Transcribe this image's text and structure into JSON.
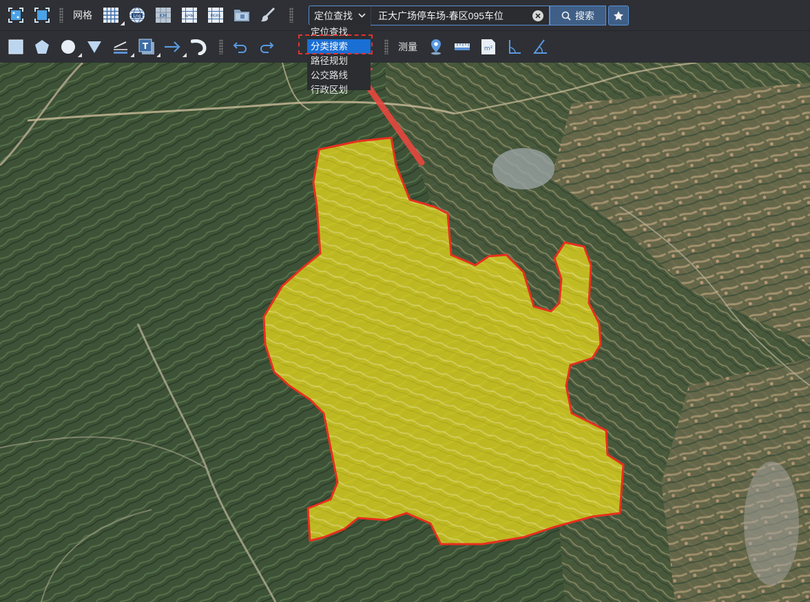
{
  "toolbar1": {
    "grid_label": "网格"
  },
  "search": {
    "type_selected": "定位查找",
    "value": "正大广场停车场-春区095车位",
    "button_label": "搜索",
    "dropdown_options": [
      "定位查找",
      "分类搜索",
      "路径规划",
      "公交路线",
      "行政区划"
    ],
    "highlighted_option": "分类搜索"
  },
  "toolbar2": {
    "measure_label": "测量"
  },
  "icons": {
    "toolbar1": [
      "fullscreen-fit-icon",
      "fullscreen-icon",
      "grid-icon",
      "lnglat-grid-icon",
      "km-grid-icon",
      "nm-grid-icon",
      "mgrs-grid-icon",
      "folder-icon",
      "brush-icon"
    ],
    "toolbar2": [
      "rectangle-icon",
      "polygon-icon",
      "circle-icon",
      "triangle-icon",
      "line-icon",
      "text-icon",
      "arrow-icon",
      "curve-icon",
      "undo-icon",
      "redo-icon",
      "location-pin-icon",
      "ruler-icon",
      "area-measure-icon",
      "angle-icon",
      "azimuth-icon",
      "star-icon"
    ]
  },
  "colors": {
    "toolbar_bg": "#2e3035",
    "accent_blue": "#1a6fd4",
    "highlight_red": "#e3332f",
    "region_fill": "#e6dc1c",
    "region_stroke": "#e8301f"
  }
}
